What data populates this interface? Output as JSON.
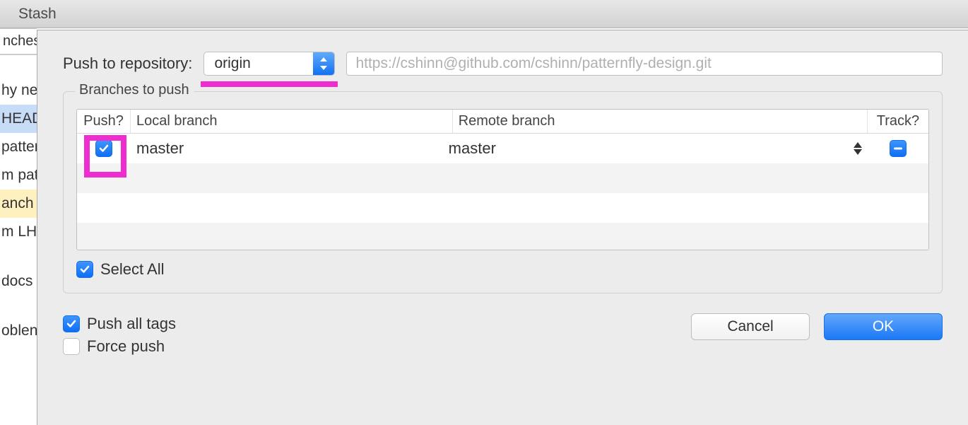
{
  "titlebar": {
    "title": "Stash"
  },
  "background": {
    "sidebar_header": "nches",
    "items": [
      {
        "label": "hy ne",
        "style": "plain"
      },
      {
        "label": "HEAD",
        "style": "blue"
      },
      {
        "label": "patter",
        "style": "plain"
      },
      {
        "label": "m pat",
        "style": "plain"
      },
      {
        "label": "anch",
        "style": "yellow"
      },
      {
        "label": "m LH",
        "style": "plain"
      }
    ],
    "extra1": "docs",
    "extra2": "oblen"
  },
  "dialog": {
    "push_label": "Push to repository:",
    "remote_selected": "origin",
    "remote_url": "https://cshinn@github.com/cshinn/patternfly-design.git",
    "branches_legend": "Branches to push",
    "columns": {
      "push": "Push?",
      "local": "Local branch",
      "remote": "Remote branch",
      "track": "Track?"
    },
    "rows": [
      {
        "push": true,
        "local": "master",
        "remote": "master",
        "track": "indeterminate"
      }
    ],
    "select_all": {
      "label": "Select All",
      "checked": true
    },
    "push_all_tags": {
      "label": "Push all tags",
      "checked": true
    },
    "force_push": {
      "label": "Force push",
      "checked": false
    },
    "buttons": {
      "cancel": "Cancel",
      "ok": "OK"
    }
  }
}
